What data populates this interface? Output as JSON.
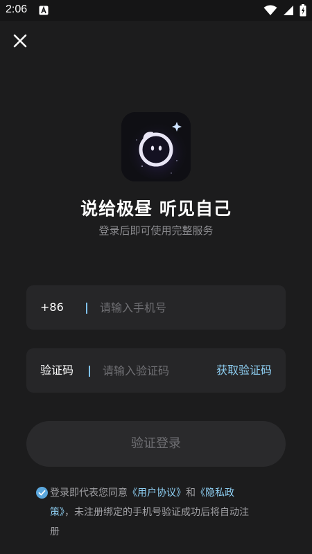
{
  "status_bar": {
    "time": "2:06",
    "icons": [
      "notification-a-icon",
      "wifi-icon",
      "cell-signal-icon",
      "battery-charging-icon"
    ]
  },
  "top_bar": {
    "close_icon": "close-icon"
  },
  "brand": {
    "logo_icon": "app-logo-icon",
    "headline": "说给极昼 听见自己",
    "subtitle": "登录后即可使用完整服务"
  },
  "phone_field": {
    "prefix": "+86",
    "value": "",
    "placeholder": "请输入手机号"
  },
  "code_field": {
    "label": "验证码",
    "value": "",
    "placeholder": "请输入验证码",
    "get_code_label": "获取验证码"
  },
  "login_button": {
    "label": "验证登录"
  },
  "agreement": {
    "checked": true,
    "prefix": "登录即代表您同意",
    "user_agreement_link": "《用户协议》",
    "and": "和",
    "privacy_link": "《隐私政策》",
    "suffix": "，未注册绑定的手机号验证成功后将自动注册"
  },
  "colors": {
    "background": "#1c1c1d",
    "field_bg": "#262628",
    "accent": "#8fd0f4",
    "check": "#5ba7dd"
  }
}
